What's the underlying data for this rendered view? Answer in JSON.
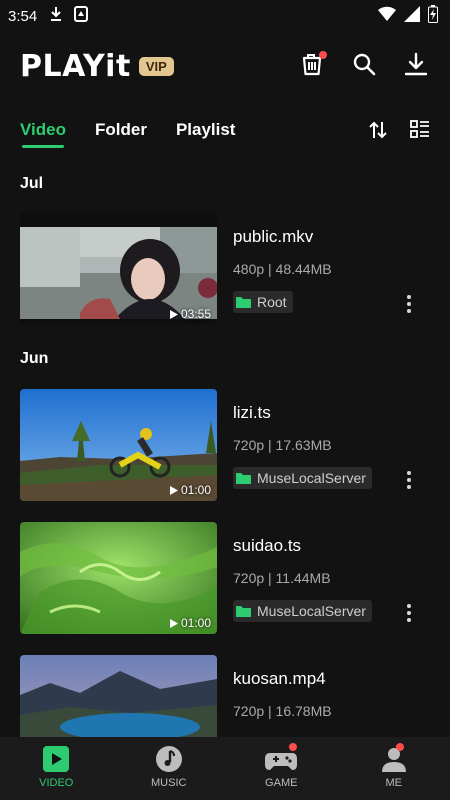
{
  "status_bar": {
    "time": "3:54"
  },
  "app_bar": {
    "logo": "PLAYit",
    "vip_label": "VIP"
  },
  "tabs": [
    {
      "label": "Video",
      "active": true
    },
    {
      "label": "Folder",
      "active": false
    },
    {
      "label": "Playlist",
      "active": false
    }
  ],
  "sections": [
    {
      "title": "Jul"
    },
    {
      "title": "Jun"
    }
  ],
  "videos": [
    {
      "title": "public.mkv",
      "meta": "480p | 48.44MB",
      "folder": "Root",
      "duration": "03:55"
    },
    {
      "title": "lizi.ts",
      "meta": "720p | 17.63MB",
      "folder": "MuseLocalServer",
      "duration": "01:00"
    },
    {
      "title": "suidao.ts",
      "meta": "720p | 11.44MB",
      "folder": "MuseLocalServer",
      "duration": "01:00"
    },
    {
      "title": "kuosan.mp4",
      "meta": "720p | 16.78MB",
      "folder": "",
      "duration": ""
    }
  ],
  "bottom_nav": [
    {
      "label": "VIDEO",
      "active": true
    },
    {
      "label": "MUSIC",
      "active": false
    },
    {
      "label": "GAME",
      "active": false
    },
    {
      "label": "ME",
      "active": false
    }
  ],
  "colors": {
    "accent": "#2ecc71",
    "background": "#121212",
    "vip": "#e3c690",
    "badge_dot": "#ff4d4d"
  }
}
